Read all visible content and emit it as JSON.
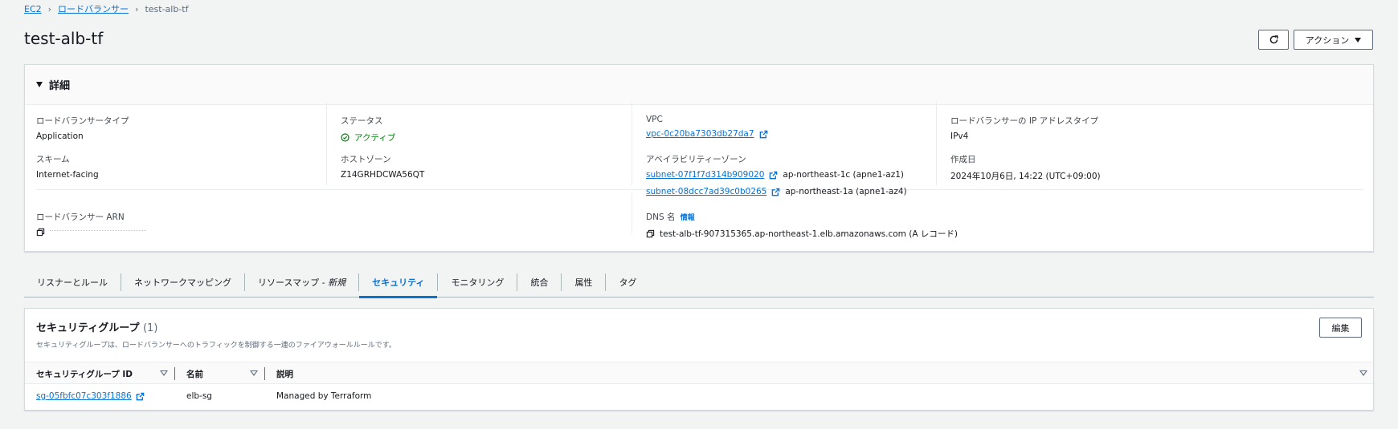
{
  "breadcrumb": {
    "items": [
      "EC2",
      "ロードバランサー"
    ],
    "current": "test-alb-tf"
  },
  "header": {
    "title": "test-alb-tf",
    "refresh_icon": "refresh-icon",
    "action_label": "アクション"
  },
  "details": {
    "title": "詳細",
    "lb_type_label": "ロードバランサータイプ",
    "lb_type_value": "Application",
    "status_label": "ステータス",
    "status_value": "アクティブ",
    "vpc_label": "VPC",
    "vpc_value": "vpc-0c20ba7303db27da7",
    "ip_type_label": "ロードバランサーの IP アドレスタイプ",
    "ip_type_value": "IPv4",
    "scheme_label": "スキーム",
    "scheme_value": "Internet-facing",
    "hosted_zone_label": "ホストゾーン",
    "hosted_zone_value": "Z14GRHDCWA56QT",
    "az_label": "アベイラビリティーゾーン",
    "az_items": [
      {
        "subnet": "subnet-07f1f7d314b909020",
        "zone": "ap-northeast-1c (apne1-az1)"
      },
      {
        "subnet": "subnet-08dcc7ad39c0b0265",
        "zone": "ap-northeast-1a (apne1-az4)"
      }
    ],
    "created_label": "作成日",
    "created_value": "2024年10月6日, 14:22 (UTC+09:00)",
    "arn_label": "ロードバランサー ARN",
    "dns_label": "DNS 名",
    "dns_info": "情報",
    "dns_value": "test-alb-tf-907315365.ap-northeast-1.elb.amazonaws.com (A レコード)",
    "status_color": "#037f0c"
  },
  "tabs": [
    {
      "label": "リスナーとルール"
    },
    {
      "label": "ネットワークマッピング"
    },
    {
      "label": "リソースマップ - ",
      "suffix": "新規"
    },
    {
      "label": "セキュリティ",
      "active": true
    },
    {
      "label": "モニタリング"
    },
    {
      "label": "統合"
    },
    {
      "label": "属性"
    },
    {
      "label": "タグ"
    }
  ],
  "security": {
    "title": "セキュリティグループ",
    "count": "(1)",
    "description": "セキュリティグループは、ロードバランサーへのトラフィックを制御する一連のファイアウォールルールです。",
    "edit_label": "編集",
    "columns": [
      "セキュリティグループ ID",
      "名前",
      "説明"
    ],
    "rows": [
      {
        "id": "sg-05fbfc07c303f1886",
        "name": "elb-sg",
        "description": "Managed by Terraform"
      }
    ]
  },
  "colors": {
    "link": "#0972d3",
    "success": "#037f0c",
    "text": "#16191f"
  }
}
